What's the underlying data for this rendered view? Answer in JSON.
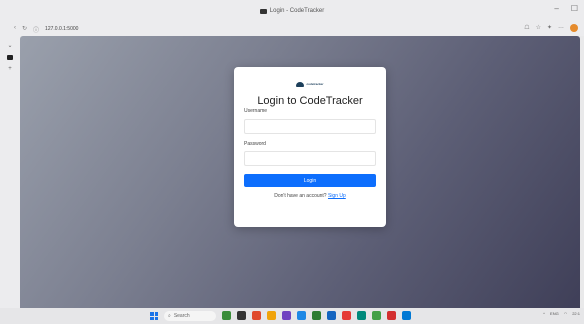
{
  "window": {
    "title": "Login - CodeTracker",
    "controls": {
      "minimize": "–",
      "maximize": "☐"
    }
  },
  "addressbar": {
    "back": "‹",
    "reload": "↻",
    "info": "ⓘ",
    "url": "127.0.0.1:5000"
  },
  "sidebar": {
    "collapse": "⌄",
    "add": "+"
  },
  "logo": {
    "word": "codetracker"
  },
  "login": {
    "title": "Login to CodeTracker",
    "username_label": "Username",
    "username_value": "",
    "password_label": "Password",
    "password_value": "",
    "button_label": "Login",
    "signup_prompt": "Don't have an account?",
    "signup_link": "Sign Up"
  },
  "taskbar": {
    "search_placeholder": "Search",
    "app_colors": [
      "#3a8d3a",
      "#333333",
      "#e0492c",
      "#f0a30a",
      "#6f42c1",
      "#1e88e5",
      "#2e7d32",
      "#1565c0",
      "#e53935",
      "#00897b",
      "#43a047",
      "#d32f2f",
      "#0078d4"
    ],
    "tray": {
      "lang": "ENG",
      "time": "22:1"
    }
  },
  "colors": {
    "accent": "#0d6efd",
    "background_start": "#9aa0ac",
    "background_end": "#3f3f58"
  }
}
